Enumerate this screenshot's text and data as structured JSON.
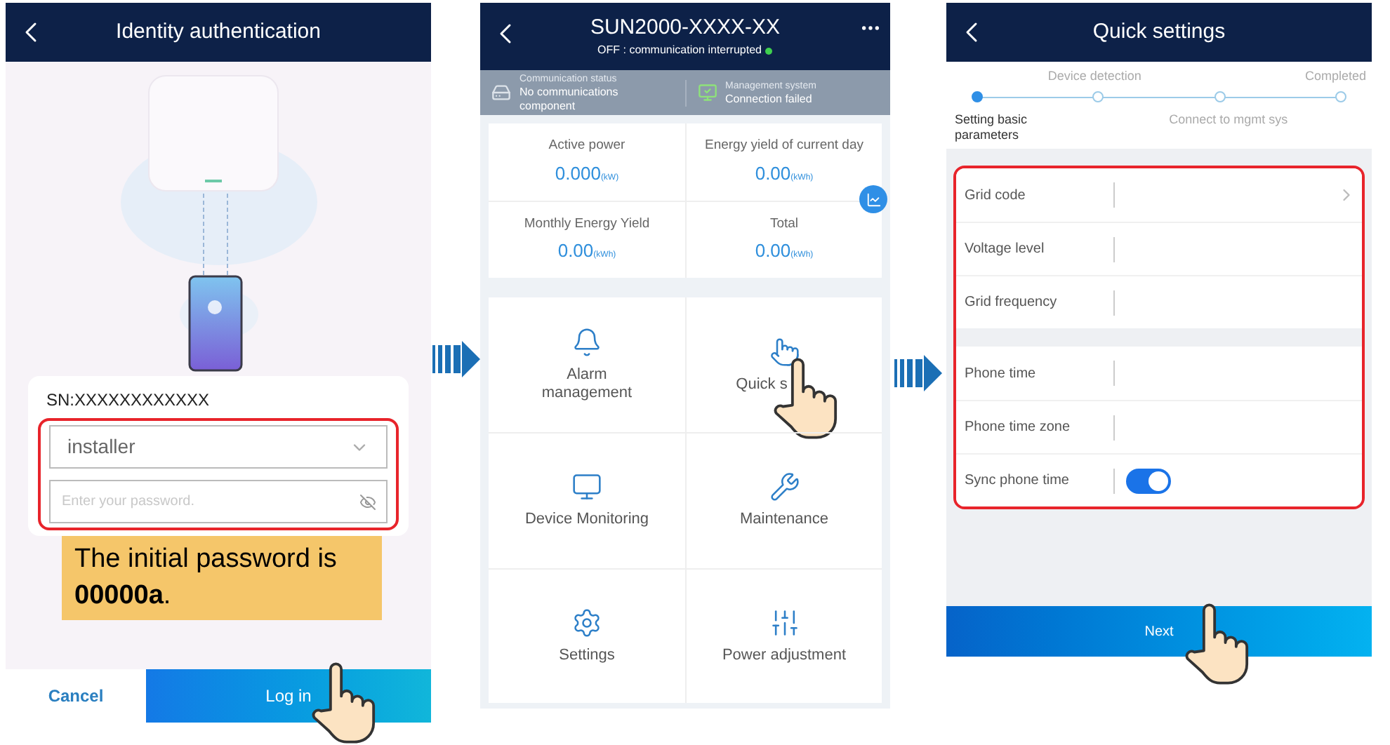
{
  "login_screen": {
    "title": "Identity authentication",
    "sn": "SN:XXXXXXXXXXXX",
    "user_field": {
      "value": "installer"
    },
    "password_field": {
      "placeholder": "Enter your password."
    },
    "note": "The initial password is **00000a**.",
    "buttons": [
      {
        "label": "Cancel",
        "kind": "secondary"
      },
      {
        "label": "Log in",
        "kind": "primary"
      }
    ]
  },
  "device_screen": {
    "title": "SUN2000-XXXX-XX",
    "status": "OFF : communication interrupted",
    "status_panels": [
      {
        "label": "Communication status",
        "value": "No communications component"
      },
      {
        "label": "Management system",
        "value": "Connection failed"
      }
    ],
    "metrics": [
      {
        "label": "Active power",
        "value": "0.000",
        "unit": "(kW)"
      },
      {
        "label": "Energy yield of current day",
        "value": "0.00",
        "unit": "(kWh)"
      },
      {
        "label": "Monthly Energy Yield",
        "value": "0.00",
        "unit": "(kWh)"
      },
      {
        "label": "Total",
        "value": "0.00",
        "unit": "(kWh)"
      }
    ],
    "menu": [
      {
        "label": "Alarm management"
      },
      {
        "label": "Quick s"
      },
      {
        "label": "Device Monitoring"
      },
      {
        "label": "Maintenance"
      },
      {
        "label": "Settings"
      },
      {
        "label": "Power adjustment"
      }
    ]
  },
  "quick_settings": {
    "title": "Quick settings",
    "steps": [
      {
        "label": "Setting basic parameters",
        "selected": true
      },
      {
        "label": "Device detection",
        "selected": false
      },
      {
        "label": "Connect to mgmt sys",
        "selected": false
      },
      {
        "label": "Completed",
        "selected": false
      }
    ],
    "groups": [
      {
        "rows": [
          {
            "label": "Grid code",
            "kind": "select"
          },
          {
            "label": "Voltage level",
            "kind": "text"
          },
          {
            "label": "Grid frequency",
            "kind": "text"
          }
        ]
      },
      {
        "rows": [
          {
            "label": "Phone time",
            "kind": "text"
          },
          {
            "label": "Phone time zone",
            "kind": "text"
          },
          {
            "label": "Sync phone time",
            "kind": "toggle",
            "on": true
          }
        ]
      }
    ],
    "next_button": "Next"
  }
}
